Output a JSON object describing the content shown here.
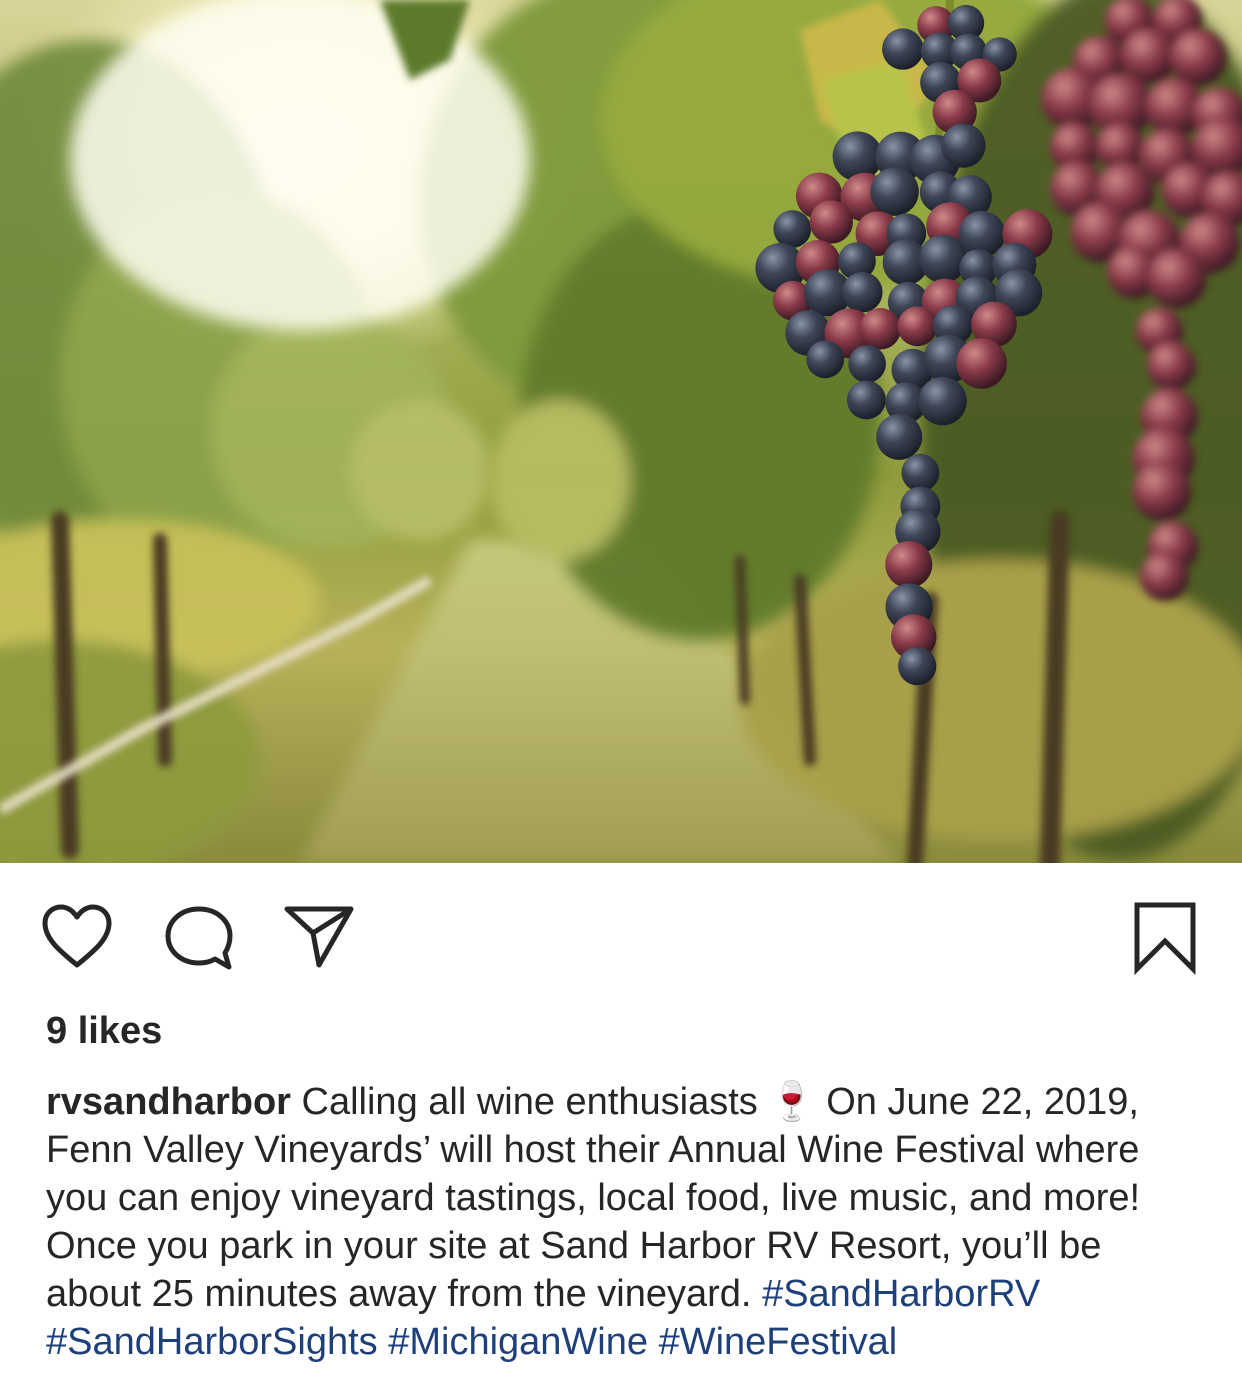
{
  "post": {
    "image_alt": "Vineyard rows with a bunch of red grapes",
    "likes": "9 likes",
    "username": "rvsandharbor",
    "caption_part1": "Calling all wine enthusiasts",
    "caption_emoji": "🍷",
    "caption_part2": "On June 22, 2019, Fenn Valley Vineyards’ will host their Annual Wine Festival where you can enjoy vineyard tastings, local food, live music, and more! Once you park in your site at Sand Harbor RV Resort, you’ll be about 25 minutes away from the vineyard.",
    "hashtags": [
      "#SandHarborRV",
      "#SandHarborSights",
      "#MichiganWine",
      "#WineFestival"
    ]
  },
  "icons": {
    "like": "heart-icon",
    "comment": "comment-bubble-icon",
    "share": "paper-plane-icon",
    "save": "bookmark-icon"
  },
  "colors": {
    "text": "#262626",
    "hashtag": "#1d3f7a",
    "background": "#ffffff"
  }
}
